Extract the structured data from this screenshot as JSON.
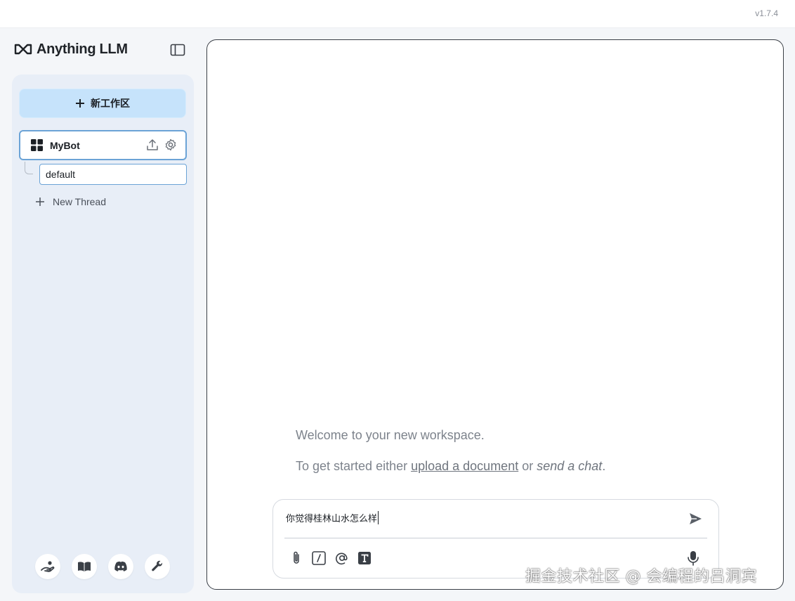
{
  "window": {
    "version": "v1.7.4"
  },
  "sidebar": {
    "logo_text": "Anything LLM",
    "new_workspace_label": "新工作区",
    "workspace": {
      "name": "MyBot"
    },
    "thread": {
      "name": "default"
    },
    "new_thread_label": "New Thread",
    "footer_icons": [
      "community-hub-icon",
      "docs-book-icon",
      "discord-icon",
      "settings-wrench-icon"
    ]
  },
  "main": {
    "welcome": "Welcome to your new workspace.",
    "started_prefix": "To get started either ",
    "started_link": "upload a document",
    "started_or": " or ",
    "started_chat": "send a chat",
    "started_suffix": ".",
    "composer": {
      "value": "你觉得桂林山水怎么样"
    }
  },
  "watermark": "掘金技术社区 @ 会编程的吕洞宾",
  "colors": {
    "accent": "#c6e3fb",
    "selected_border": "#6ba3d6",
    "sidebar_bg": "#e8eef7",
    "app_bg": "#f4f6f9"
  }
}
